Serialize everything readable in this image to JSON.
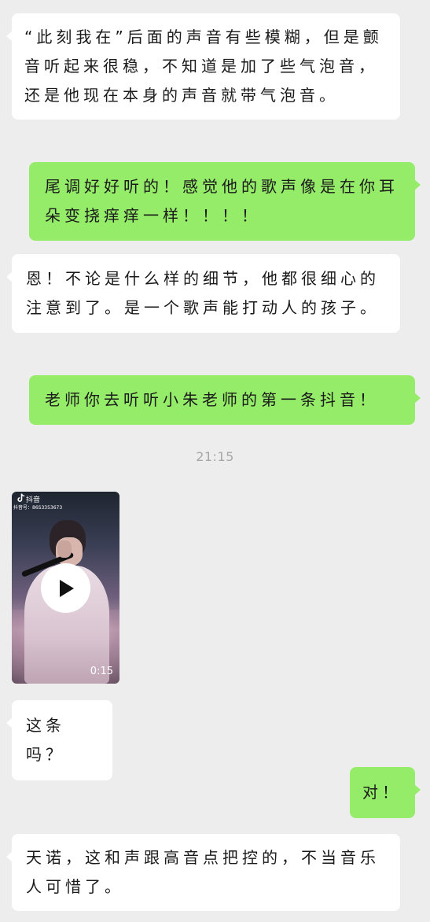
{
  "messages": [
    {
      "id": "m1",
      "side": "left",
      "text": "“此刻我在”后面的声音有些模糊，但是颤音听起来很稳，不知道是加了些气泡音，还是他现在本身的声音就带气泡音。"
    },
    {
      "id": "m2",
      "side": "right",
      "text": "尾调好好听的！感觉他的歌声像是在你耳朵变挠痒痒一样！！！！"
    },
    {
      "id": "m3",
      "side": "left",
      "text": "恩！不论是什么样的细节，他都很细心的注意到了。是一个歌声能打动人的孩子。"
    },
    {
      "id": "m4",
      "side": "right",
      "text": "老师你去听听小朱老师的第一条抖音！"
    },
    {
      "id": "m6",
      "side": "left",
      "text": "这条吗？"
    },
    {
      "id": "m7",
      "side": "right",
      "text": "对！"
    },
    {
      "id": "m8",
      "side": "left",
      "text": "天诺，这和声跟高音点把控的，不当音乐人可惜了。"
    }
  ],
  "timestamp": "21:15",
  "video": {
    "app_label": "抖音",
    "account_id": "抖音号：86S3353673",
    "duration": "0:15",
    "icons": {
      "play": "play-icon",
      "app": "tiktok-logo-icon"
    }
  },
  "colors": {
    "background": "#ededed",
    "incoming_bubble": "#ffffff",
    "outgoing_bubble": "#95ec69",
    "timestamp": "#a6a6a6"
  }
}
